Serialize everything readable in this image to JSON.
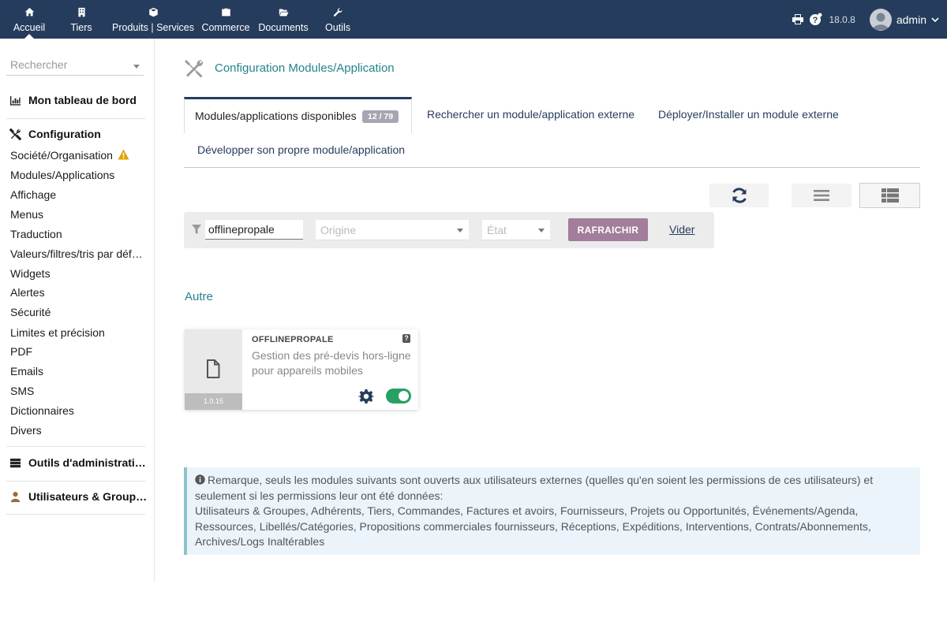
{
  "topnav": {
    "items": [
      {
        "label": "Accueil",
        "icon": "home-icon"
      },
      {
        "label": "Tiers",
        "icon": "building-icon"
      },
      {
        "label": "Produits | Services",
        "icon": "cube-icon"
      },
      {
        "label": "Commerce",
        "icon": "briefcase-icon"
      },
      {
        "label": "Documents",
        "icon": "folder-open-icon"
      },
      {
        "label": "Outils",
        "icon": "wrench-icon"
      }
    ],
    "version": "18.0.8",
    "user": "admin"
  },
  "sidebar": {
    "search_placeholder": "Rechercher",
    "dashboard": "Mon tableau de bord",
    "config_title": "Configuration",
    "config_items": [
      "Société/Organisation",
      "Modules/Applications",
      "Affichage",
      "Menus",
      "Traduction",
      "Valeurs/filtres/tris par déf…",
      "Widgets",
      "Alertes",
      "Sécurité",
      "Limites et précision",
      "PDF",
      "Emails",
      "SMS",
      "Dictionnaires",
      "Divers"
    ],
    "admin_tools": "Outils d'administrati…",
    "users_groups": "Utilisateurs & Group…"
  },
  "main": {
    "title": "Configuration Modules/Application",
    "tabs": [
      {
        "label": "Modules/applications disponibles",
        "badge": "12 / 79"
      },
      {
        "label": "Rechercher un module/application externe"
      },
      {
        "label": "Déployer/Installer un module externe"
      },
      {
        "label": "Développer son propre module/application"
      }
    ],
    "filter": {
      "search_value": "offlinepropale",
      "origin_placeholder": "Origine",
      "state_placeholder": "État",
      "refresh_label": "RAFRAICHIR",
      "clear_label": "Vider"
    },
    "section": "Autre",
    "module": {
      "name": "OFFLINEPROPALE",
      "description": "Gestion des pré-devis hors-ligne pour appareils mobiles",
      "version": "1.0.15",
      "help": "?",
      "enabled": true
    },
    "note": {
      "text1": "Remarque, seuls les modules suivants sont ouverts aux utilisateurs externes (quelles qu'en soient les permissions de ces utilisateurs) et seulement si les permissions leur ont été données:",
      "text2": "Utilisateurs & Groupes, Adhérents, Tiers, Commandes, Factures et avoirs, Fournisseurs, Projets ou Opportunités, Événements/Agenda, Ressources, Libellés/Catégories, Propositions commerciales fournisseurs, Réceptions, Expéditions, Interventions, Contrats/Abonnements, Archives/Logs Inaltérables"
    }
  },
  "colors": {
    "topbar": "#263c5c",
    "accent_teal": "#23848c",
    "refresh_button": "#a27d9c",
    "toggle_on": "#28a063",
    "warning": "#e2a100"
  }
}
